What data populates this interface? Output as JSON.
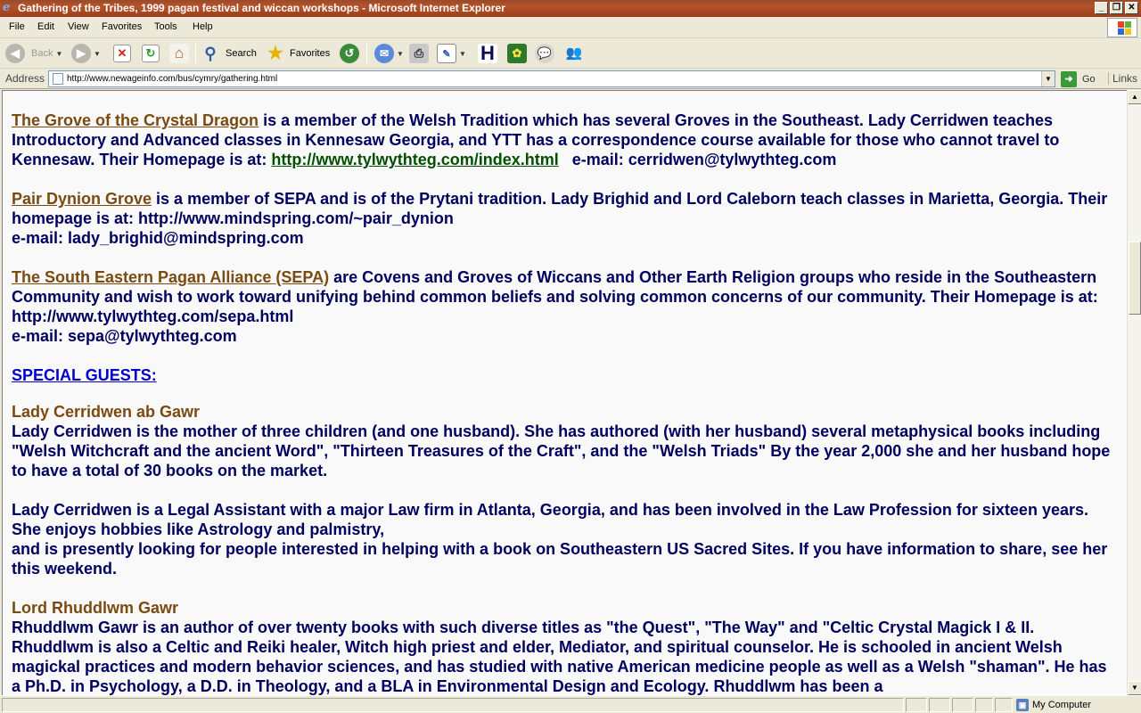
{
  "window": {
    "title": "Gathering of the Tribes, 1999 pagan festival and wiccan workshops - Microsoft Internet Explorer",
    "minimize": "_",
    "maximize": "❐",
    "close": "✕"
  },
  "menu": [
    "File",
    "Edit",
    "View",
    "Favorites",
    "Tools",
    "Help"
  ],
  "toolbar": {
    "back_label": "Back",
    "search_label": "Search",
    "favorites_label": "Favorites"
  },
  "address": {
    "label": "Address",
    "url": "http://www.newageinfo.com/bus/cymry/gathering.html",
    "go_label": "Go",
    "links_label": "Links"
  },
  "content": {
    "p1": {
      "link": "The Grove of the Crystal Dragon",
      "text": " is a member of the Welsh Tradition which has several Groves in the Southeast. Lady Cerridwen teaches Introductory and Advanced classes in Kennesaw Georgia, and YTT has a correspondence course available for those who cannot travel to Kennesaw. Their Homepage is at: ",
      "url": "http://www.tylwythteg.com/index.html",
      "email": "   e-mail: cerridwen@tylwythteg.com"
    },
    "p2": {
      "link": "Pair Dynion Grove",
      "text": " is a member of SEPA and is of the Prytani tradition. Lady Brighid and Lord Caleborn teach classes in Marietta, Georgia. Their homepage is at: http://www.mindspring.com/~pair_dynion",
      "email": "e-mail: lady_brighid@mindspring.com"
    },
    "p3": {
      "link": "The South Eastern Pagan Alliance (SEPA)",
      "text": " are Covens and Groves of Wiccans and Other Earth Religion groups who reside in the Southeastern Community and wish to work toward unifying behind common beliefs and solving common concerns of our community. Their Homepage is at: http://www.tylwythteg.com/sepa.html",
      "email": "e-mail: sepa@tylwythteg.com"
    },
    "special_guests": "SPECIAL GUESTS:",
    "guest1": {
      "name": "Lady Cerridwen ab Gawr",
      "bio1": "Lady Cerridwen is the mother of three children (and one husband). She has authored (with her husband) several metaphysical books including \"Welsh Witchcraft and the ancient Word\", \"Thirteen Treasures of the Craft\", and the \"Welsh Triads\" By the year 2,000 she and her husband hope to have a total of 30 books on the market.",
      "bio2a": "Lady Cerridwen is a Legal Assistant with a major Law firm in Atlanta, Georgia, and has been involved in the Law Profession for sixteen years. She enjoys hobbies like Astrology and palmistry,",
      "bio2b": "and is presently looking for people interested in helping with a book on Southeastern US Sacred Sites. If you have information to share, see her this weekend."
    },
    "guest2": {
      "name": "Lord Rhuddlwm Gawr",
      "bio": "Rhuddlwm Gawr is an author of over twenty books with such diverse titles as \"the Quest\", \"The Way\" and \"Celtic Crystal Magick I & II. Rhuddlwm is also a Celtic and Reiki healer, Witch high priest and elder, Mediator, and spiritual counselor. He is schooled in ancient Welsh magickal practices and modern behavior sciences, and has studied with native American medicine people as well as a Welsh \"shaman\". He has a Ph.D. in Psychology, a D.D. in Theology, and a BLA in Environmental Design and Ecology. Rhuddlwm has been a"
    }
  },
  "status": {
    "zone": "My Computer"
  }
}
